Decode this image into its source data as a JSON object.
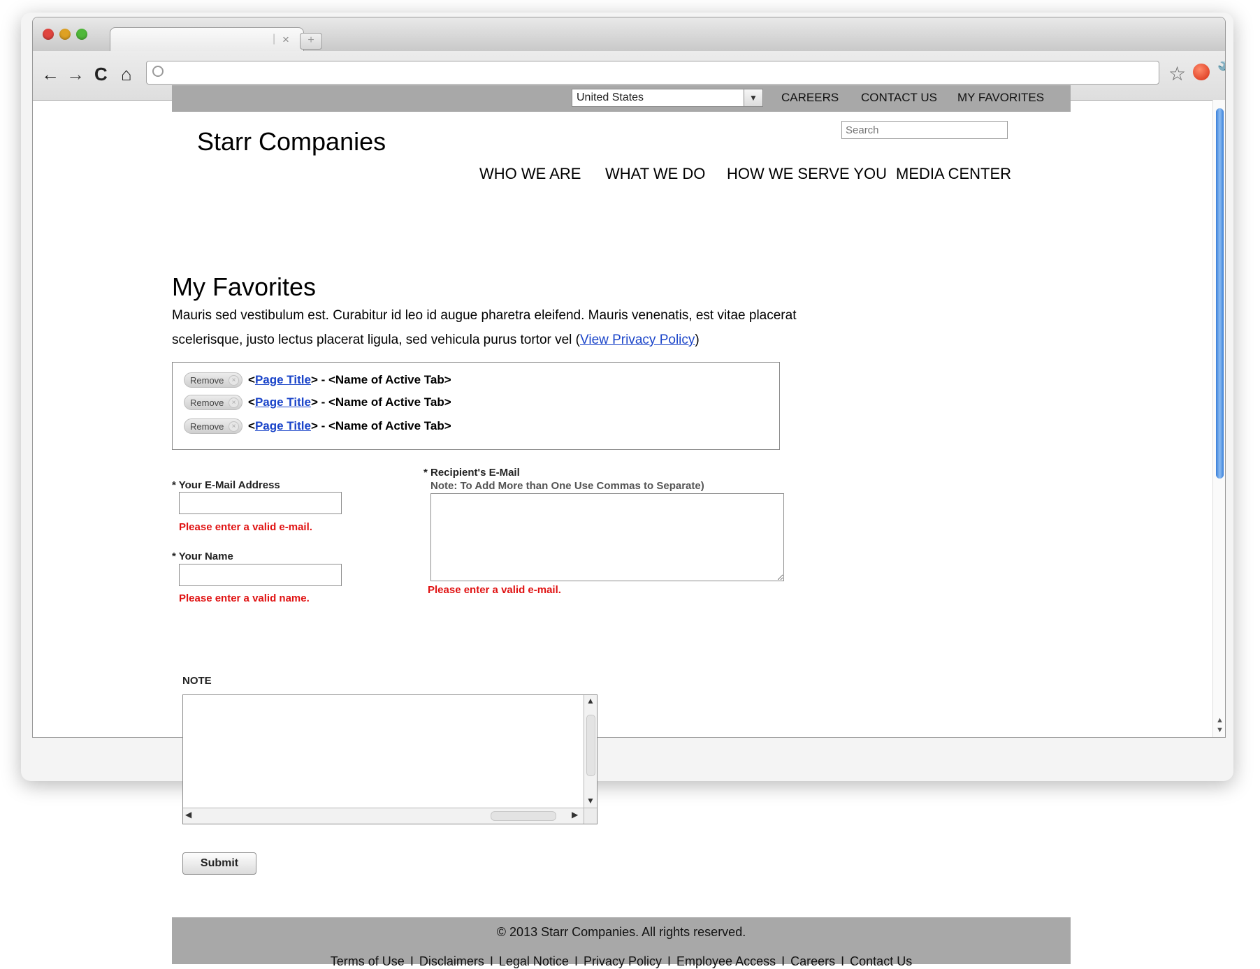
{
  "browser": {
    "tab_close_glyph": "×",
    "newtab_glyph": "+",
    "back_glyph": "←",
    "forward_glyph": "→",
    "reload_glyph": "C",
    "home_glyph": "⌂",
    "star_glyph": "☆",
    "wrench_glyph": "🔧",
    "icons": [
      "back-icon",
      "forward-icon",
      "reload-icon",
      "home-icon",
      "globe-icon",
      "star-icon",
      "extension-icon",
      "wrench-icon"
    ]
  },
  "utility_bar": {
    "country_selected": "United States",
    "links": [
      "CAREERS",
      "CONTACT US",
      "MY FAVORITES"
    ]
  },
  "header": {
    "logo": "Starr Companies",
    "search_placeholder": "Search",
    "nav": [
      "WHO WE ARE",
      "WHAT WE DO",
      "HOW WE SERVE YOU",
      "MEDIA CENTER"
    ]
  },
  "main": {
    "title": "My Favorites",
    "intro_text": "Mauris sed vestibulum est. Curabitur id leo id augue pharetra eleifend. Mauris venenatis, est vitae placerat scelerisque, justo lectus placerat ligula, sed vehicula purus tortor vel (",
    "privacy_link": "View Privacy Policy",
    "intro_close": ")",
    "favorites": [
      {
        "remove_label": "Remove",
        "prefix": "<",
        "page_title": "Page Title",
        "suffix": "> - <Name of Active Tab>"
      },
      {
        "remove_label": "Remove",
        "prefix": "<",
        "page_title": "Page Title",
        "suffix": "> - <Name of Active Tab>"
      },
      {
        "remove_label": "Remove",
        "prefix": "<",
        "page_title": "Page Title",
        "suffix": "> - <Name of Active Tab>"
      }
    ]
  },
  "form": {
    "email_label": "* Your E-Mail Address",
    "email_value": "",
    "email_error": "Please enter a valid e-mail.",
    "name_label": "* Your Name",
    "name_value": "",
    "name_error": "Please enter a valid name.",
    "recipient_label": "* Recipient's E-Mail",
    "recipient_note": "Note: To Add More than One Use Commas to Separate)",
    "recipient_value": "",
    "recipient_error": "Please enter a valid e-mail.",
    "note_label": "NOTE",
    "note_value": "",
    "submit_label": "Submit"
  },
  "footer": {
    "copyright": "© 2013 Starr Companies. All rights reserved.",
    "links": [
      "Terms of Use",
      "Disclaimers",
      "Legal Notice",
      "Privacy Policy",
      "Employee Access",
      "Careers",
      "Contact Us"
    ],
    "separator": "I"
  }
}
